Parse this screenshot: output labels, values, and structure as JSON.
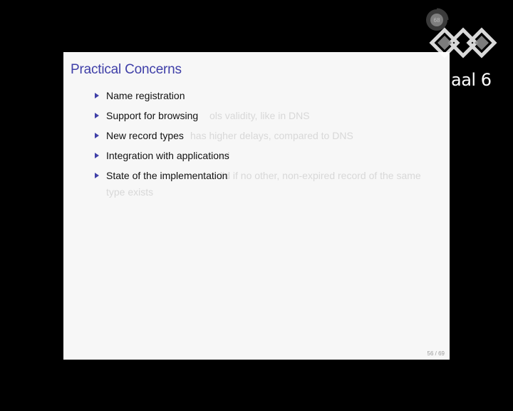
{
  "slide": {
    "title": "Practical Concerns",
    "bullets": [
      "Name registration",
      "Support for browsing",
      "New record types",
      "Integration with applications",
      "State of the implementation"
    ],
    "ghost_lines": [
      "ols validity, like in DNS",
      "has higher delays, compared to DNS",
      "rd",
      "lid if no other, non-expired record of the same",
      "type exists"
    ],
    "page_number": "56 / 69"
  },
  "overlay": {
    "badge_number": "68",
    "room_label": "aal 6"
  },
  "colors": {
    "title": "#3f3fa8",
    "bullet": "#3f3fa8",
    "slide_bg": "#f7f7f7",
    "page_bg": "#000000"
  }
}
